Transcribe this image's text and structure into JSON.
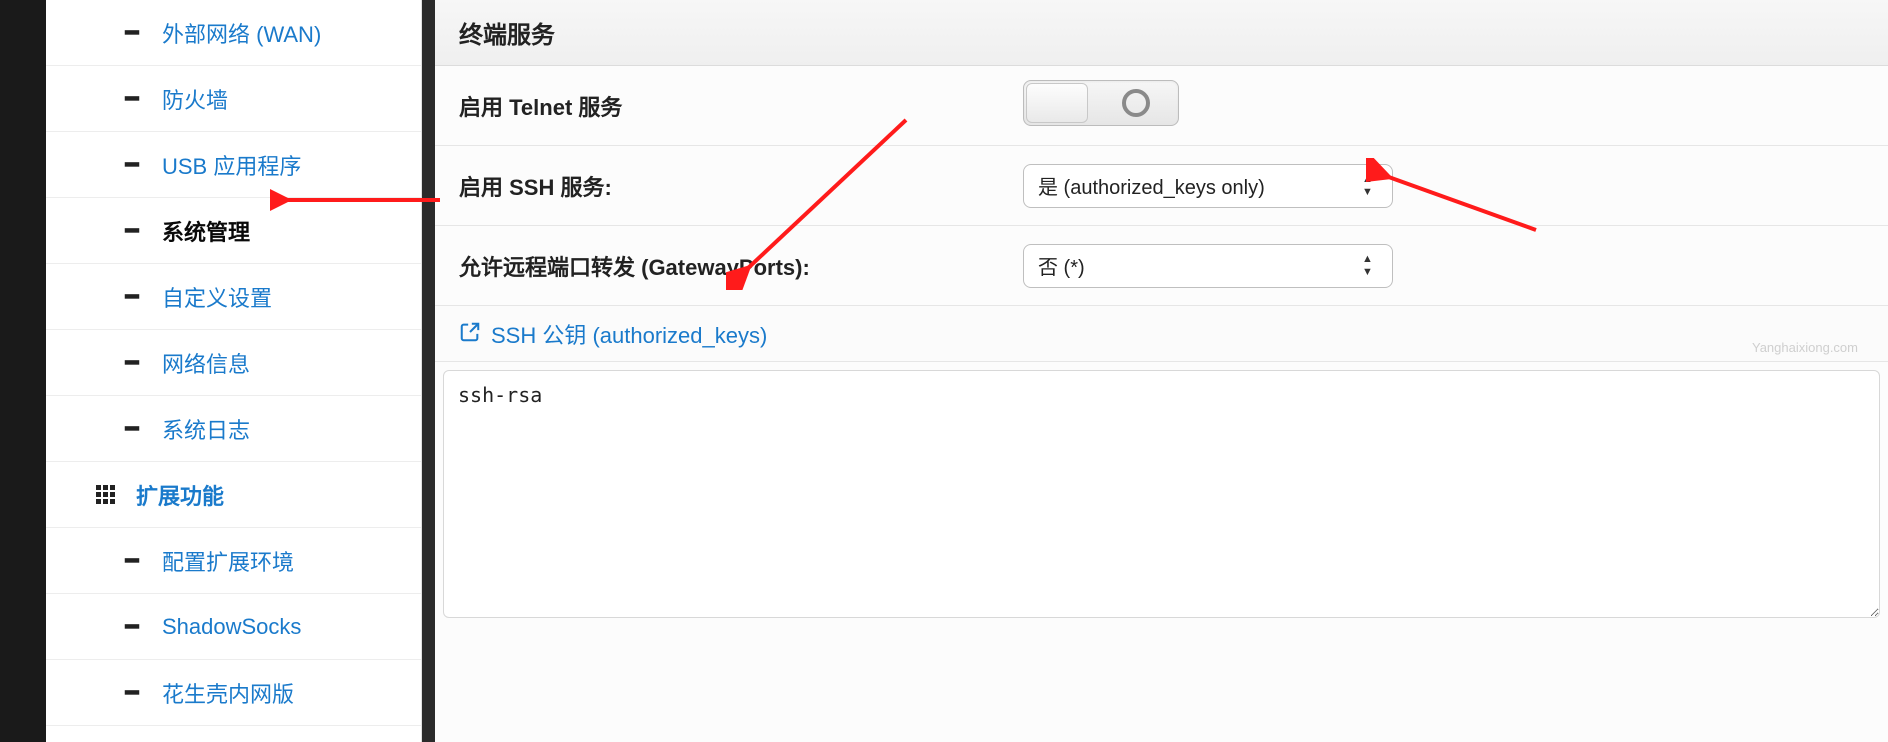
{
  "sidebar": {
    "items": [
      {
        "label": "外部网络 (WAN)"
      },
      {
        "label": "防火墙"
      },
      {
        "label": "USB 应用程序"
      },
      {
        "label": "系统管理"
      },
      {
        "label": "自定义设置"
      },
      {
        "label": "网络信息"
      },
      {
        "label": "系统日志"
      }
    ],
    "group": {
      "label": "扩展功能"
    },
    "groupItems": [
      {
        "label": "配置扩展环境"
      },
      {
        "label": "ShadowSocks"
      },
      {
        "label": "花生壳内网版"
      }
    ]
  },
  "panel": {
    "title": "终端服务",
    "telnet_label": "启用 Telnet 服务",
    "ssh_label": "启用 SSH 服务:",
    "ssh_value": "是 (authorized_keys only)",
    "gateway_label": "允许远程端口转发 (GatewayPorts):",
    "gateway_value": "否 (*)",
    "ssh_keys_header": "SSH 公钥 (authorized_keys)",
    "ssh_keys_value": "ssh-rsa ",
    "watermark": "Yanghaixiong.com"
  }
}
